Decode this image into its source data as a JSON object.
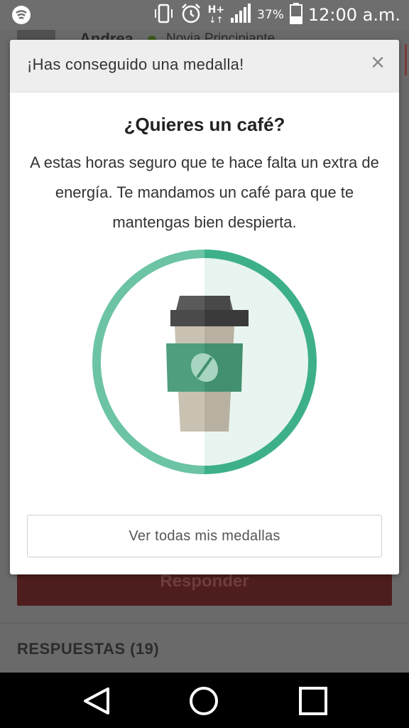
{
  "status_bar": {
    "battery": "37%",
    "time": "12:00 a.m.",
    "network_label": "H+",
    "icons": [
      "wifi-hotspot-icon",
      "vibrate-icon",
      "alarm-icon",
      "network-type-icon",
      "signal-icon",
      "battery-icon"
    ]
  },
  "background": {
    "user_name": "Andrea",
    "user_rank": "Novia Principiante",
    "reply_button": "Responder",
    "answers_header": "RESPUESTAS (19)"
  },
  "dialog": {
    "title": "¡Has conseguido una medalla!",
    "close_label": "×",
    "medal_title": "¿Quieres un café?",
    "medal_description": "A estas horas seguro que te hace falta un extra de energía. Te mandamos un café para que te mantengas bien despierta.",
    "all_medals_button": "Ver todas mis medallas",
    "medal_icon": "coffee-cup-icon",
    "colors": {
      "ring": "#5bbf9c",
      "ring_dark": "#3db08a",
      "sleeve": "#4a9a78",
      "cup": "#c9c2b3",
      "lid": "#4a4a4a"
    }
  },
  "nav_bar": {
    "buttons": [
      "back-icon",
      "home-icon",
      "recents-icon"
    ]
  }
}
